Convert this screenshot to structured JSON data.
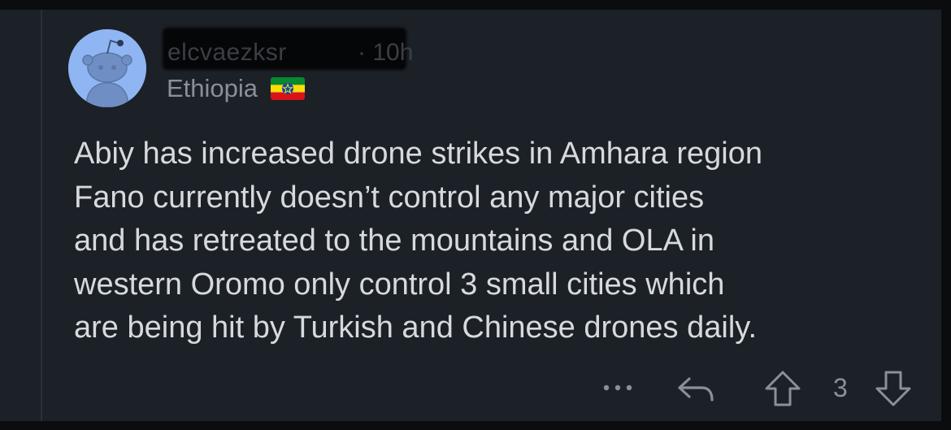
{
  "comment": {
    "author": "elcvaezksr",
    "separator": "·",
    "age": "10h",
    "flair_text": "Ethiopia",
    "flair_emoji": "ethiopia-flag",
    "body": "Abiy has increased drone strikes in Amhara region\nFano currently doesn’t control any major cities\nand has retreated to the mountains and OLA in\nwestern Oromo only control 3 small cities which\nare being hit by Turkish and Chinese drones daily."
  },
  "actions": {
    "more": "more-options-icon",
    "reply": "reply-icon",
    "upvote": "upvote-icon",
    "vote_count": "3",
    "downvote": "downvote-icon"
  },
  "colors": {
    "background": "#1c2128",
    "text": "#d7dadc",
    "muted": "#8a9099",
    "avatar": "#8fb6f2"
  }
}
